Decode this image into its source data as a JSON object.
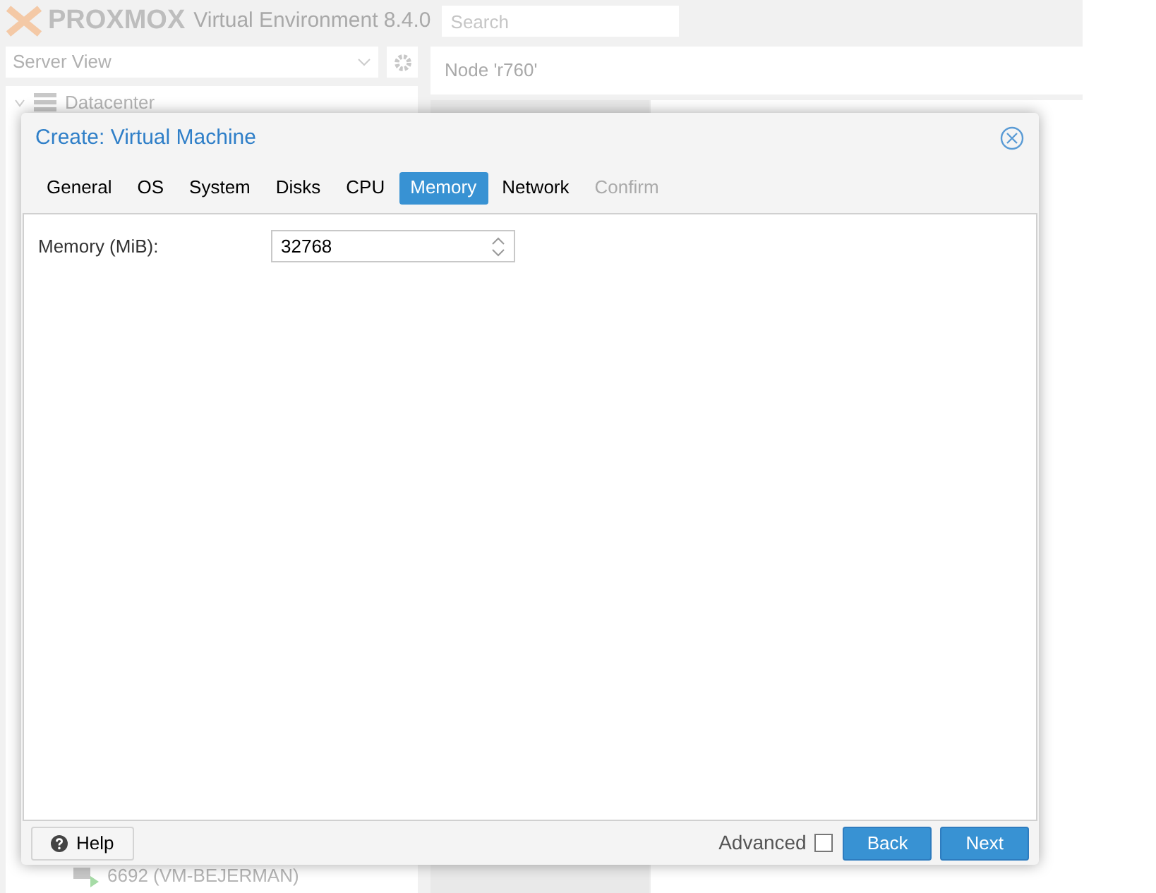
{
  "header": {
    "logo": "PROXMOX",
    "product": "Virtual Environment 8.4.0",
    "search": {
      "placeholder": "Search"
    }
  },
  "sidebar": {
    "view": "Server View",
    "tree": [
      {
        "label": "Datacenter",
        "expanded": true
      },
      {
        "label": "6692 (VM-BEJERMAN)",
        "kind": "vm"
      }
    ]
  },
  "content": {
    "title": "Node 'r760'"
  },
  "dialog": {
    "title": "Create: Virtual Machine",
    "tabs": [
      {
        "label": "General",
        "selected": false,
        "disabled": false
      },
      {
        "label": "OS",
        "selected": false,
        "disabled": false
      },
      {
        "label": "System",
        "selected": false,
        "disabled": false
      },
      {
        "label": "Disks",
        "selected": false,
        "disabled": false
      },
      {
        "label": "CPU",
        "selected": false,
        "disabled": false
      },
      {
        "label": "Memory",
        "selected": true,
        "disabled": false
      },
      {
        "label": "Network",
        "selected": false,
        "disabled": false
      },
      {
        "label": "Confirm",
        "selected": false,
        "disabled": true
      }
    ],
    "fields": [
      {
        "label": "Memory (MiB):",
        "value": "32768"
      }
    ],
    "footer": {
      "help": "Help",
      "advanced": {
        "label": "Advanced",
        "checked": false
      },
      "back": "Back",
      "next": "Next"
    }
  }
}
